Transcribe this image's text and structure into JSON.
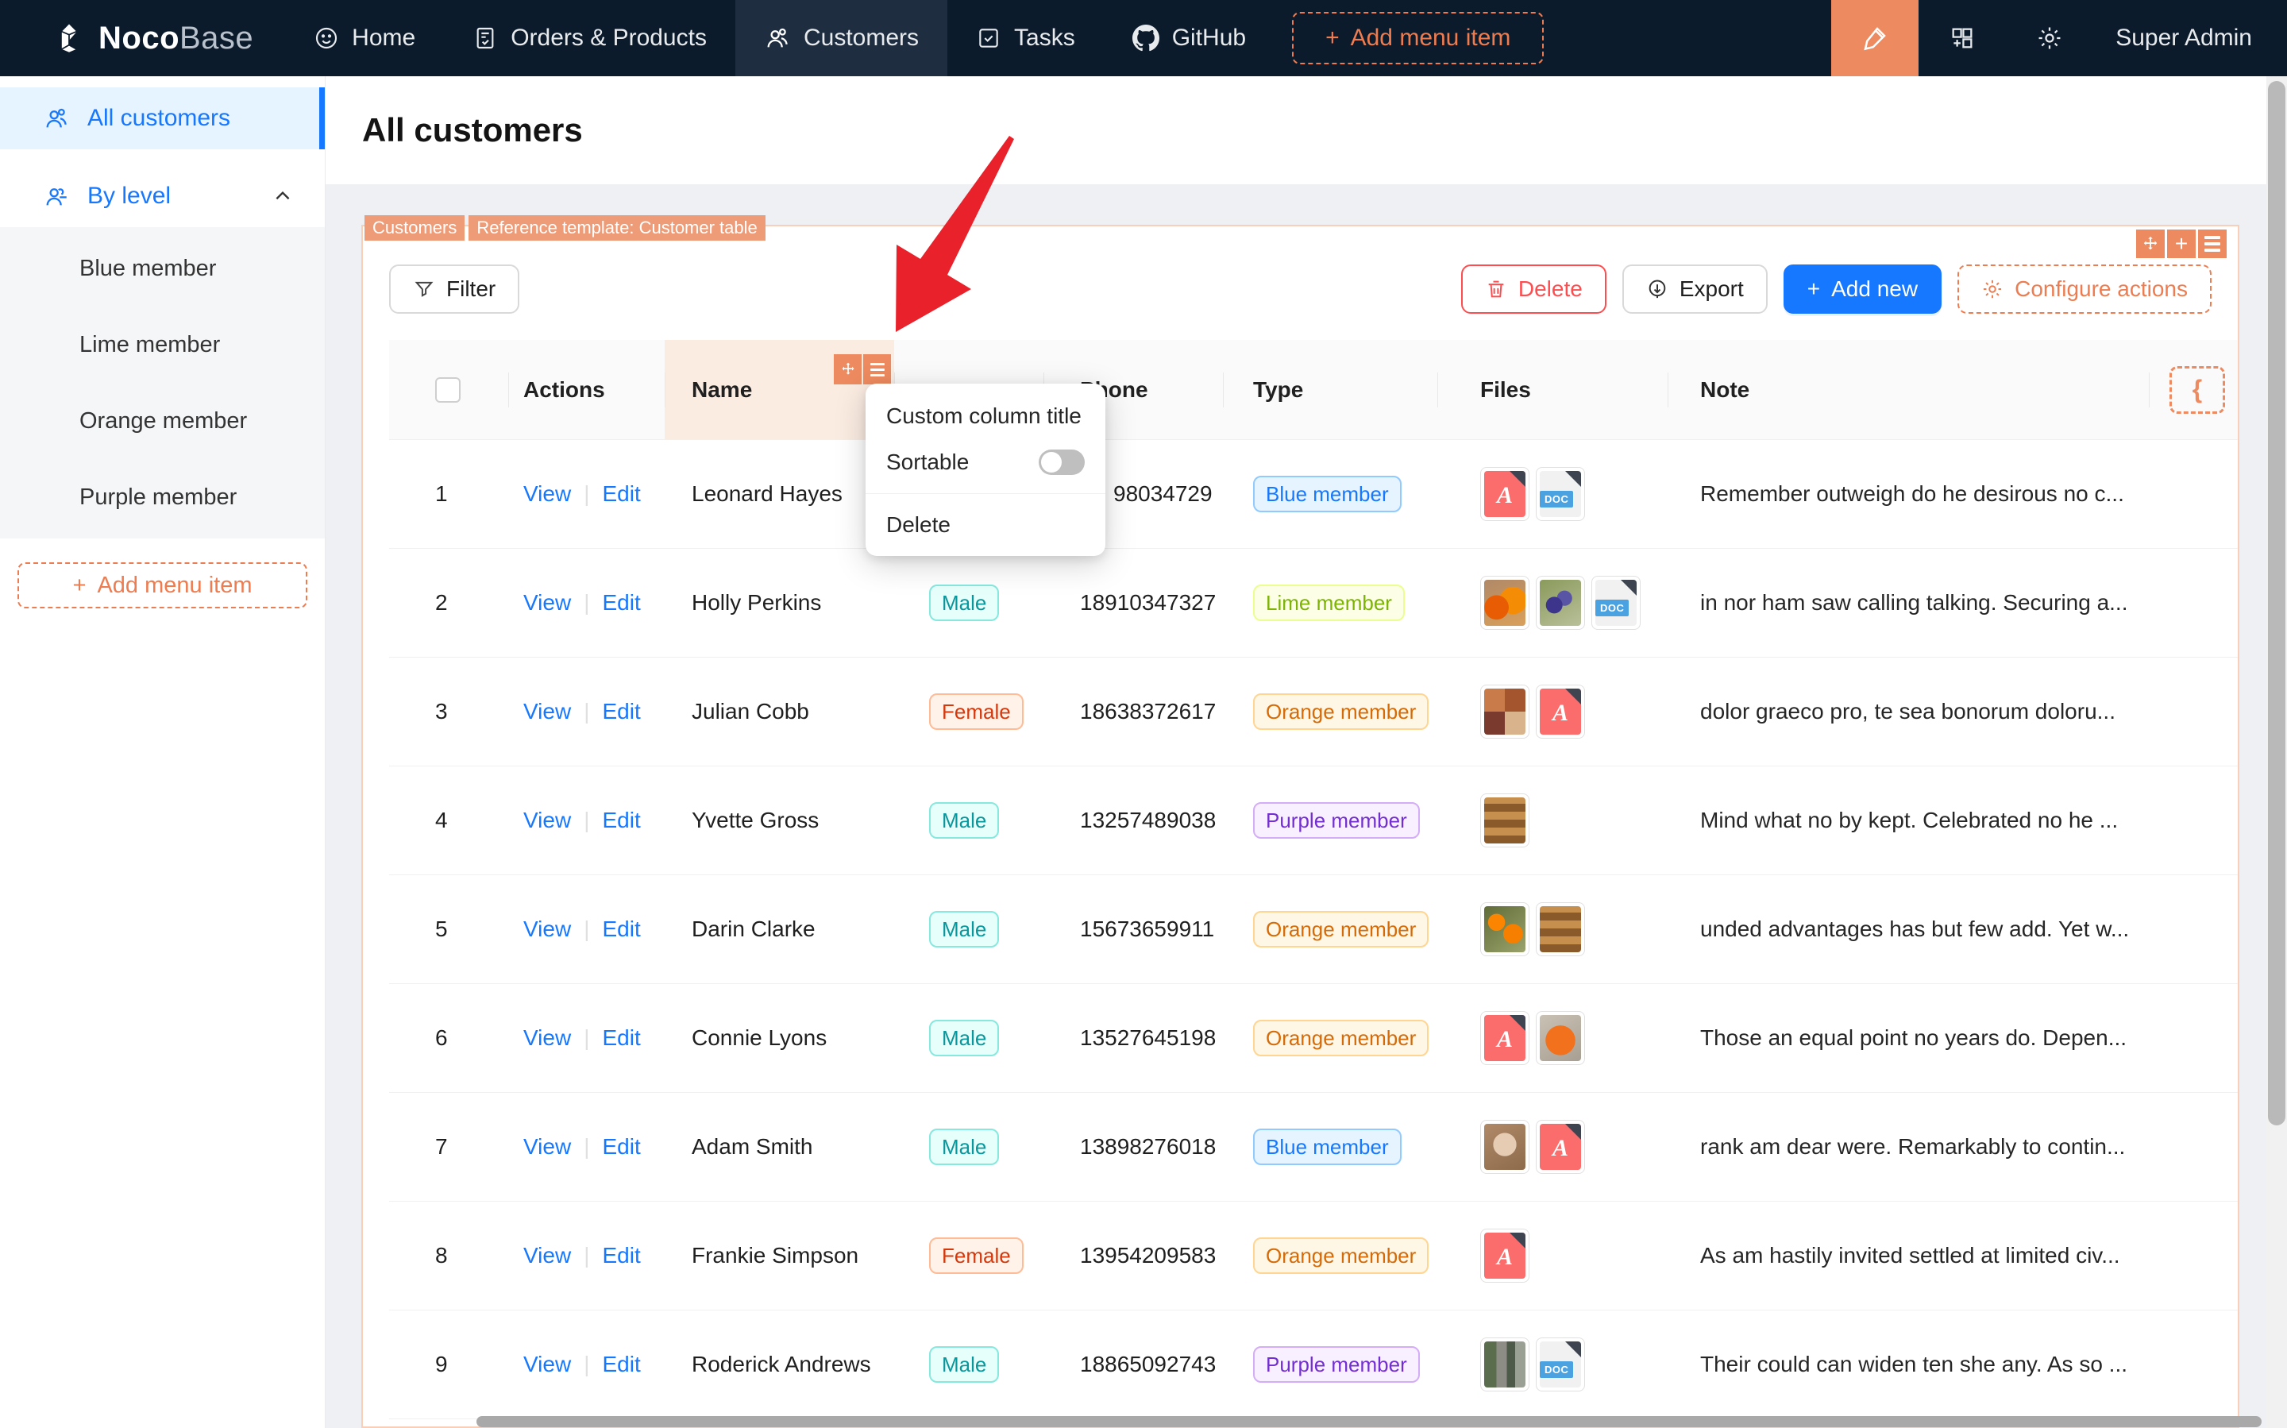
{
  "navbar": {
    "logo": {
      "bold": "Noco",
      "light": "Base"
    },
    "items": [
      {
        "label": "Home"
      },
      {
        "label": "Orders & Products"
      },
      {
        "label": "Customers",
        "active": true
      },
      {
        "label": "Tasks"
      },
      {
        "label": "GitHub"
      }
    ],
    "add_menu_item": "Add menu item",
    "user": "Super Admin"
  },
  "sidebar": {
    "all_customers": "All customers",
    "by_level": "By level",
    "levels": [
      "Blue member",
      "Lime member",
      "Orange member",
      "Purple member"
    ],
    "add_menu_item": "Add menu item"
  },
  "page": {
    "title": "All customers"
  },
  "block": {
    "tags": [
      "Customers",
      "Reference template: Customer table"
    ],
    "filter": "Filter",
    "delete": "Delete",
    "export": "Export",
    "add_new": "Add new",
    "configure_actions": "Configure actions",
    "header_extra_glyph": "{"
  },
  "table": {
    "headers": {
      "actions": "Actions",
      "name": "Name",
      "phone": "Phone",
      "type": "Type",
      "files": "Files",
      "note": "Note"
    },
    "view": "View",
    "edit": "Edit",
    "doc_label": "DOC",
    "rows": [
      {
        "index": "1",
        "name": "Leonard Hayes",
        "gender": "",
        "phone": "98034729",
        "phone_partial": true,
        "type": "Blue member",
        "type_key": "blue",
        "files": [
          "pdf",
          "doc"
        ],
        "note": "Remember outweigh do he desirous no c..."
      },
      {
        "index": "2",
        "name": "Holly Perkins",
        "gender": "Male",
        "phone": "18910347327",
        "phone_partial": false,
        "type": "Lime member",
        "type_key": "lime",
        "files": [
          "photo-fruit",
          "photo-grapes",
          "doc"
        ],
        "note": "in nor ham saw calling talking. Securing a..."
      },
      {
        "index": "3",
        "name": "Julian Cobb",
        "gender": "Female",
        "phone": "18638372617",
        "phone_partial": false,
        "type": "Orange member",
        "type_key": "orange",
        "files": [
          "photo-collage",
          "pdf"
        ],
        "note": "dolor graeco pro, te sea bonorum doloru..."
      },
      {
        "index": "4",
        "name": "Yvette Gross",
        "gender": "Male",
        "phone": "13257489038",
        "phone_partial": false,
        "type": "Purple member",
        "type_key": "purple",
        "files": [
          "photo-sushi"
        ],
        "note": "Mind what no by kept. Celebrated no he ..."
      },
      {
        "index": "5",
        "name": "Darin Clarke",
        "gender": "Male",
        "phone": "15673659911",
        "phone_partial": false,
        "type": "Orange member",
        "type_key": "orange",
        "files": [
          "photo-oranges",
          "photo-sushi"
        ],
        "note": "unded advantages has but few add. Yet w..."
      },
      {
        "index": "6",
        "name": "Connie Lyons",
        "gender": "Male",
        "phone": "13527645198",
        "phone_partial": false,
        "type": "Orange member",
        "type_key": "orange",
        "files": [
          "pdf",
          "photo-pumpkin"
        ],
        "note": "Those an equal point no years do. Depen..."
      },
      {
        "index": "7",
        "name": "Adam Smith",
        "gender": "Male",
        "phone": "13898276018",
        "phone_partial": false,
        "type": "Blue member",
        "type_key": "blue",
        "files": [
          "photo-latte",
          "pdf"
        ],
        "note": "rank am dear were. Remarkably to contin..."
      },
      {
        "index": "8",
        "name": "Frankie Simpson",
        "gender": "Female",
        "phone": "13954209583",
        "phone_partial": false,
        "type": "Orange member",
        "type_key": "orange",
        "files": [
          "pdf"
        ],
        "note": "As am hastily invited settled at limited civ..."
      },
      {
        "index": "9",
        "name": "Roderick Andrews",
        "gender": "Male",
        "phone": "18865092743",
        "phone_partial": false,
        "type": "Purple member",
        "type_key": "purple",
        "files": [
          "photo-store",
          "doc"
        ],
        "note": "Their could can widen ten she any. As so ..."
      }
    ]
  },
  "popup": {
    "custom_column_title": "Custom column title",
    "sortable": "Sortable",
    "sortable_on": false,
    "delete": "Delete"
  },
  "colors": {
    "accent_orange": "#ed7d51",
    "designer_orange": "#ed8a5f",
    "tag_orange": "#ee9b77",
    "primary_blue": "#1677ff",
    "danger_red": "#ff4d4f",
    "navbar_bg": "#0c1b2c"
  }
}
